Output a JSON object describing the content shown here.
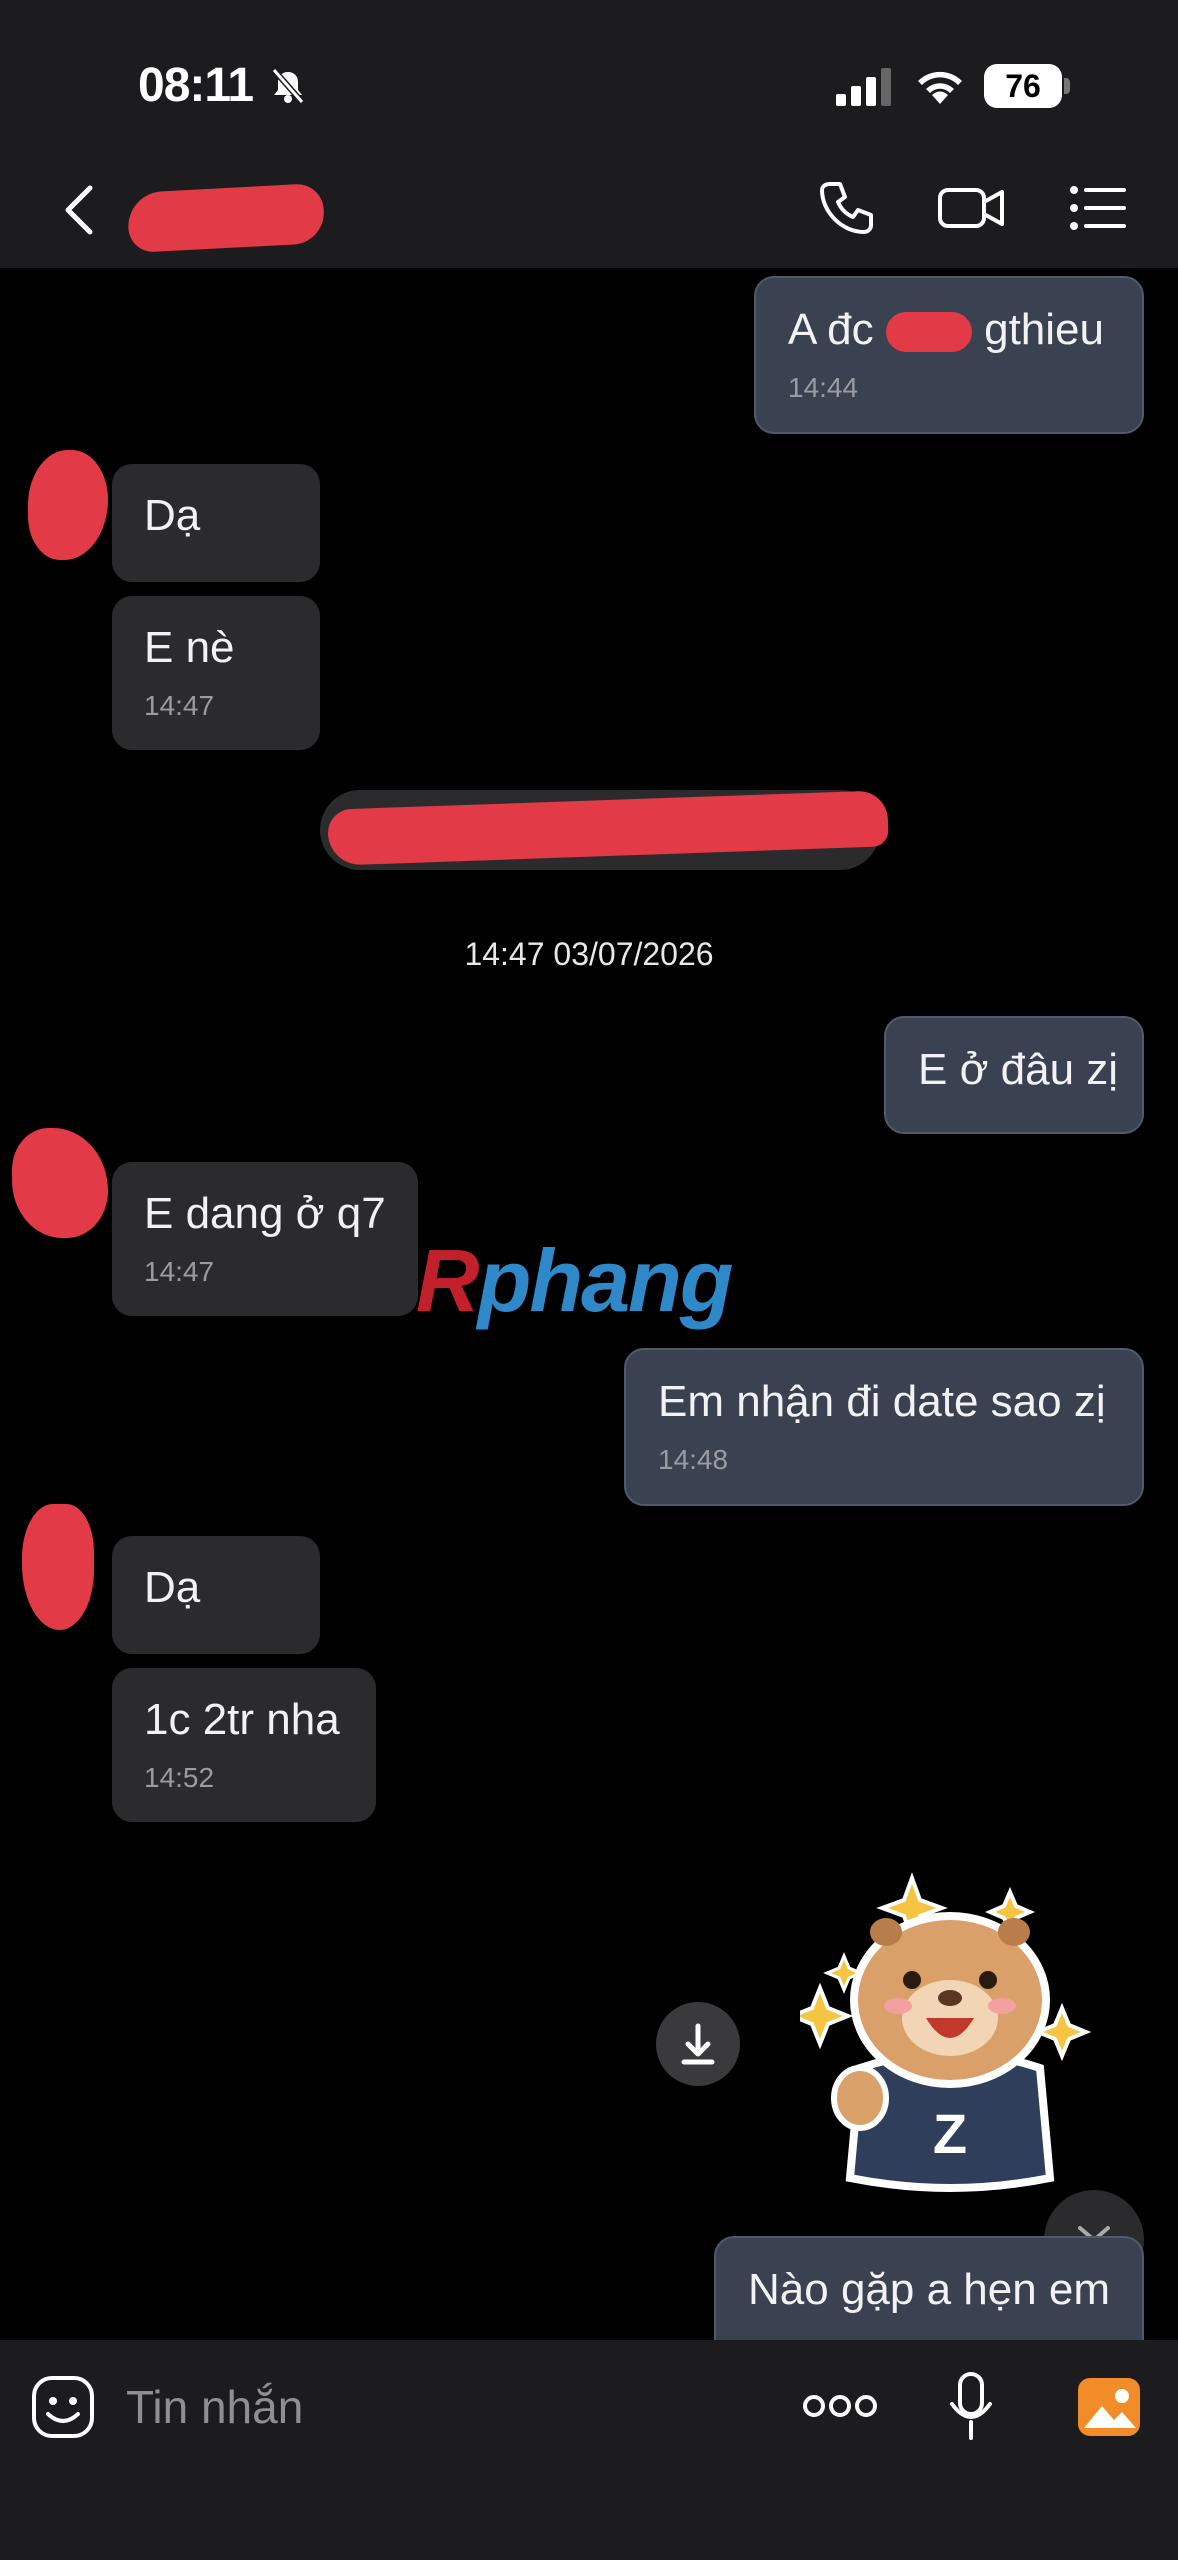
{
  "status_bar": {
    "time": "08:11",
    "battery": "76"
  },
  "header": {
    "contact_name": ""
  },
  "messages": [
    {
      "dir": "out",
      "text": "A đc",
      "text2": "gthieu",
      "time": "14:44"
    },
    {
      "dir": "in",
      "text": "Dạ"
    },
    {
      "dir": "in",
      "text": "E nè",
      "time": "14:47"
    },
    {
      "dir": "out",
      "text": "E ở đâu zị"
    },
    {
      "dir": "in",
      "text": "E dang ở q7",
      "time": "14:47"
    },
    {
      "dir": "out",
      "text": "Em nhận đi date sao zị",
      "time": "14:48"
    },
    {
      "dir": "in",
      "text": "Dạ"
    },
    {
      "dir": "in",
      "text": "1c 2tr nha",
      "time": "14:52"
    },
    {
      "dir": "out",
      "text": "Nào gặp a hẹn em"
    }
  ],
  "date_separator": "14:47 03/07/2026",
  "watermark": {
    "first": "R",
    "rest": "phang"
  },
  "sticker": {
    "letter": "Z"
  },
  "composer": {
    "placeholder": "Tin nhắn"
  },
  "colors": {
    "bubble_in": "#2b2b2d",
    "bubble_out": "#3a4150",
    "accent_photo": "#f28c28",
    "redaction": "#e23a47"
  }
}
